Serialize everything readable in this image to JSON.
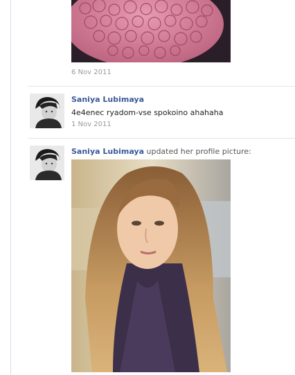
{
  "feed": {
    "posts": [
      {
        "date": "6 Nov 2011"
      },
      {
        "author": "Saniya Lubimaya",
        "text": "4e4enec ryadom-vse spokoino ahahaha",
        "date": "1 Nov 2011"
      },
      {
        "author": "Saniya Lubimaya",
        "action": "updated her profile picture:"
      }
    ]
  },
  "colors": {
    "author_link": "#3b5998",
    "date": "#999999",
    "divider": "#e5e5e5"
  }
}
